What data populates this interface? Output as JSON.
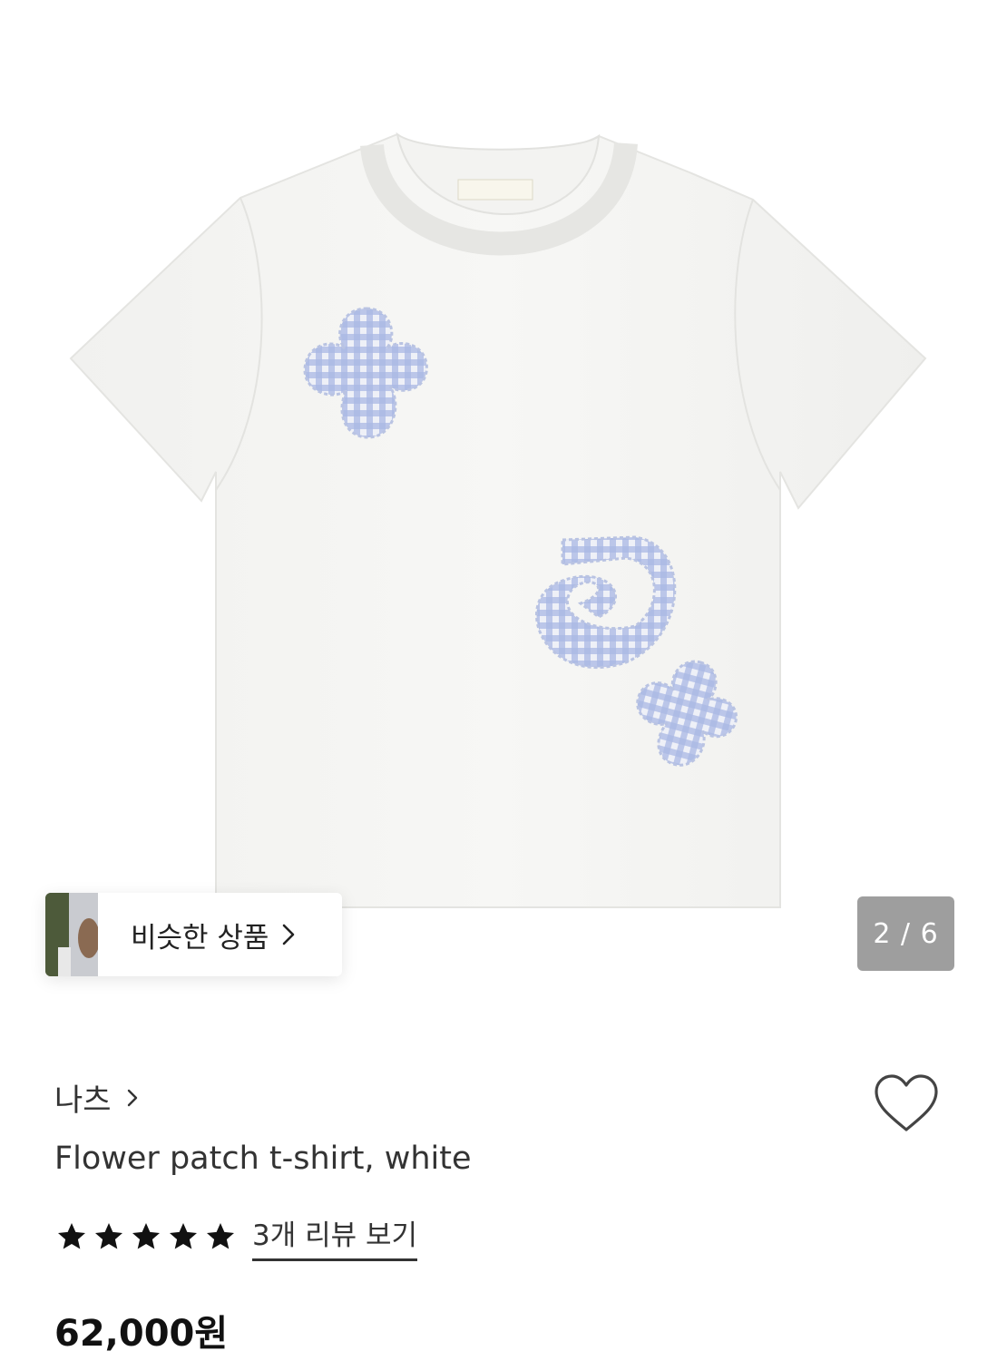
{
  "gallery": {
    "similar_label": "비슷한 상품",
    "counter": "2 / 6"
  },
  "product": {
    "brand": "나츠",
    "title": "Flower patch t-shirt, white",
    "rating": {
      "stars": 5,
      "max": 5
    },
    "review_link": "3개 리뷰 보기",
    "price": "62,000원"
  },
  "colors": {
    "gingham": "#8fa3d8",
    "counter_bg": "#9e9e9e"
  }
}
